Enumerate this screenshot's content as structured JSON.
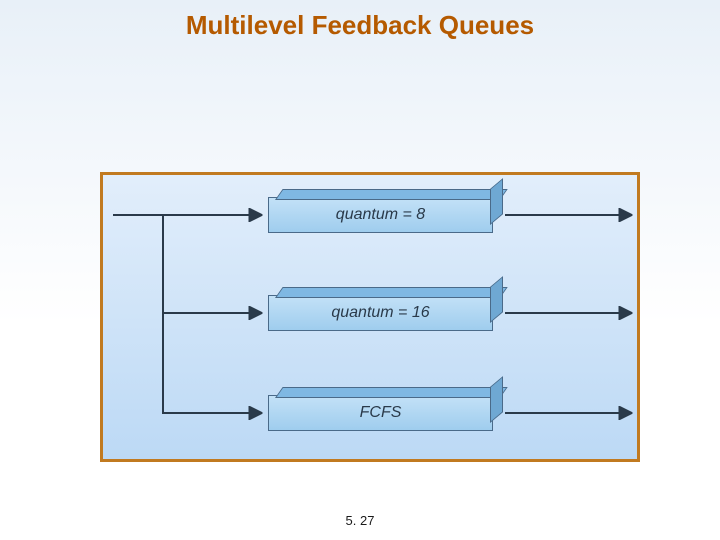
{
  "title": "Multilevel Feedback Queues",
  "page_number": "5. 27",
  "queues": {
    "q0": {
      "label": "quantum = 8"
    },
    "q1": {
      "label": "quantum = 16"
    },
    "q2": {
      "label": "FCFS"
    }
  },
  "chart_data": {
    "type": "diagram",
    "title": "Multilevel Feedback Queues",
    "nodes": [
      {
        "id": "q0",
        "label": "quantum = 8",
        "kind": "queue"
      },
      {
        "id": "q1",
        "label": "quantum = 16",
        "kind": "queue"
      },
      {
        "id": "q2",
        "label": "FCFS",
        "kind": "queue"
      }
    ],
    "edges": [
      {
        "from": "in",
        "to": "q0"
      },
      {
        "from": "q0",
        "to": "out"
      },
      {
        "from": "q0",
        "to": "q1"
      },
      {
        "from": "q1",
        "to": "out"
      },
      {
        "from": "q1",
        "to": "q2"
      },
      {
        "from": "q2",
        "to": "out"
      }
    ]
  }
}
